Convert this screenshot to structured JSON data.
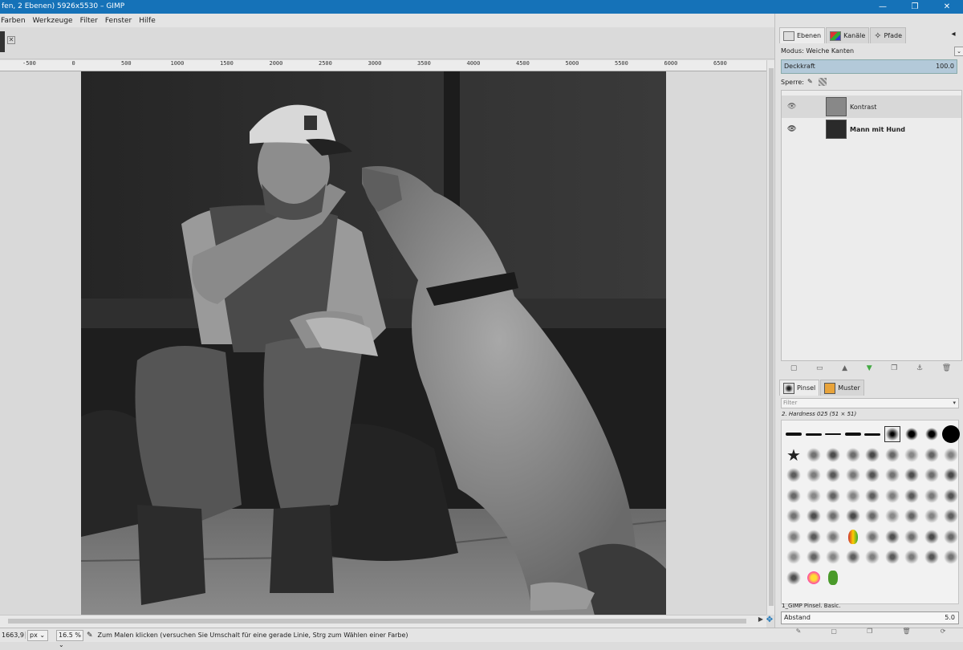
{
  "window": {
    "title": "fen, 2 Ebenen) 5926x5530 – GIMP",
    "minimize": "—",
    "maximize": "❐",
    "close": "✕"
  },
  "menu": [
    "Farben",
    "Werkzeuge",
    "Filter",
    "Fenster",
    "Hilfe"
  ],
  "ruler_ticks": [
    "-500",
    "0",
    "500",
    "1000",
    "1500",
    "2000",
    "2500",
    "3000",
    "3500",
    "4000",
    "4500",
    "5000",
    "5500",
    "6000",
    "6500"
  ],
  "status": {
    "coord": "1663,9",
    "unit": "px",
    "zoom": "16.5 %",
    "message": "Zum Malen klicken (versuchen Sie Umschalt für eine gerade Linie, Strg zum Wählen einer Farbe)"
  },
  "dock": {
    "tabs": [
      "Ebenen",
      "Kanäle",
      "Pfade"
    ],
    "mode_label": "Modus: Weiche Kanten",
    "opacity_label": "Deckkraft",
    "opacity_value": "100.0",
    "lock_label": "Sperre:",
    "layers": [
      {
        "name": "Kontrast",
        "visible": true,
        "selected": true
      },
      {
        "name": "Mann mit Hund",
        "visible": true,
        "selected": false
      }
    ],
    "brush_tabs": [
      "Pinsel",
      "Muster"
    ],
    "filter_placeholder": "Filter",
    "brush_name": "2. Hardness 025 (51 × 51)",
    "brush_set": "1_GIMP Pinsel. Basic.",
    "spacing_label": "Abstand",
    "spacing_value": "5.0"
  },
  "colors": {
    "titlebar": "#1572b8",
    "opacity_bar": "#b3c9d9"
  }
}
